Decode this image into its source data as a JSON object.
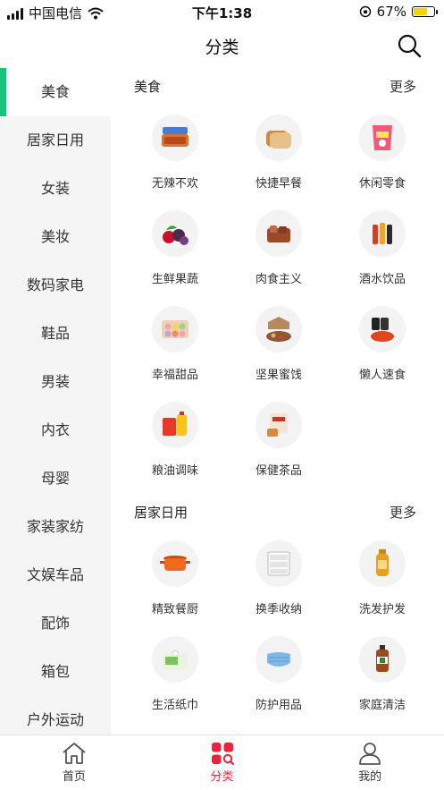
{
  "status_bar": {
    "carrier": "中国电信",
    "time": "下午1:38",
    "battery": "67%",
    "battery_level": 0.67
  },
  "header": {
    "title": "分类",
    "search_icon": "search-icon"
  },
  "sidebar": {
    "accent_color": "#19c47a",
    "items": [
      {
        "label": "美食"
      },
      {
        "label": "居家日用"
      },
      {
        "label": "女装"
      },
      {
        "label": "美妆"
      },
      {
        "label": "数码家电"
      },
      {
        "label": "鞋品"
      },
      {
        "label": "男装"
      },
      {
        "label": "内衣"
      },
      {
        "label": "母婴"
      },
      {
        "label": "家装家纺"
      },
      {
        "label": "文娱车品"
      },
      {
        "label": "配饰"
      },
      {
        "label": "箱包"
      },
      {
        "label": "户外运动"
      }
    ]
  },
  "sections": [
    {
      "title": "美食",
      "more": "更多",
      "items": [
        {
          "label": "无辣不欢",
          "icon": "spicy-food-icon"
        },
        {
          "label": "快捷早餐",
          "icon": "bread-icon"
        },
        {
          "label": "休闲零食",
          "icon": "snack-bag-icon"
        },
        {
          "label": "生鲜果蔬",
          "icon": "fruit-icon"
        },
        {
          "label": "肉食主义",
          "icon": "meat-icon"
        },
        {
          "label": "酒水饮品",
          "icon": "drink-bottles-icon"
        },
        {
          "label": "幸福甜品",
          "icon": "macaron-icon"
        },
        {
          "label": "坚果蜜饯",
          "icon": "nut-box-icon"
        },
        {
          "label": "懒人速食",
          "icon": "instant-noodle-icon"
        },
        {
          "label": "粮油调味",
          "icon": "rice-oil-icon"
        },
        {
          "label": "保健茶品",
          "icon": "tea-icon"
        }
      ]
    },
    {
      "title": "居家日用",
      "more": "更多",
      "items": [
        {
          "label": "精致餐厨",
          "icon": "cooking-pot-icon"
        },
        {
          "label": "换季收纳",
          "icon": "storage-drawer-icon"
        },
        {
          "label": "洗发护发",
          "icon": "shampoo-bottle-icon"
        },
        {
          "label": "生活纸巾",
          "icon": "tissue-pack-icon"
        },
        {
          "label": "防护用品",
          "icon": "face-mask-icon"
        },
        {
          "label": "家庭清洁",
          "icon": "cleaner-bottle-icon"
        }
      ]
    }
  ],
  "tabbar": {
    "items": [
      {
        "label": "首页",
        "icon": "home-icon"
      },
      {
        "label": "分类",
        "icon": "category-icon",
        "active_color": "#e8233b"
      },
      {
        "label": "我的",
        "icon": "profile-icon"
      }
    ]
  }
}
